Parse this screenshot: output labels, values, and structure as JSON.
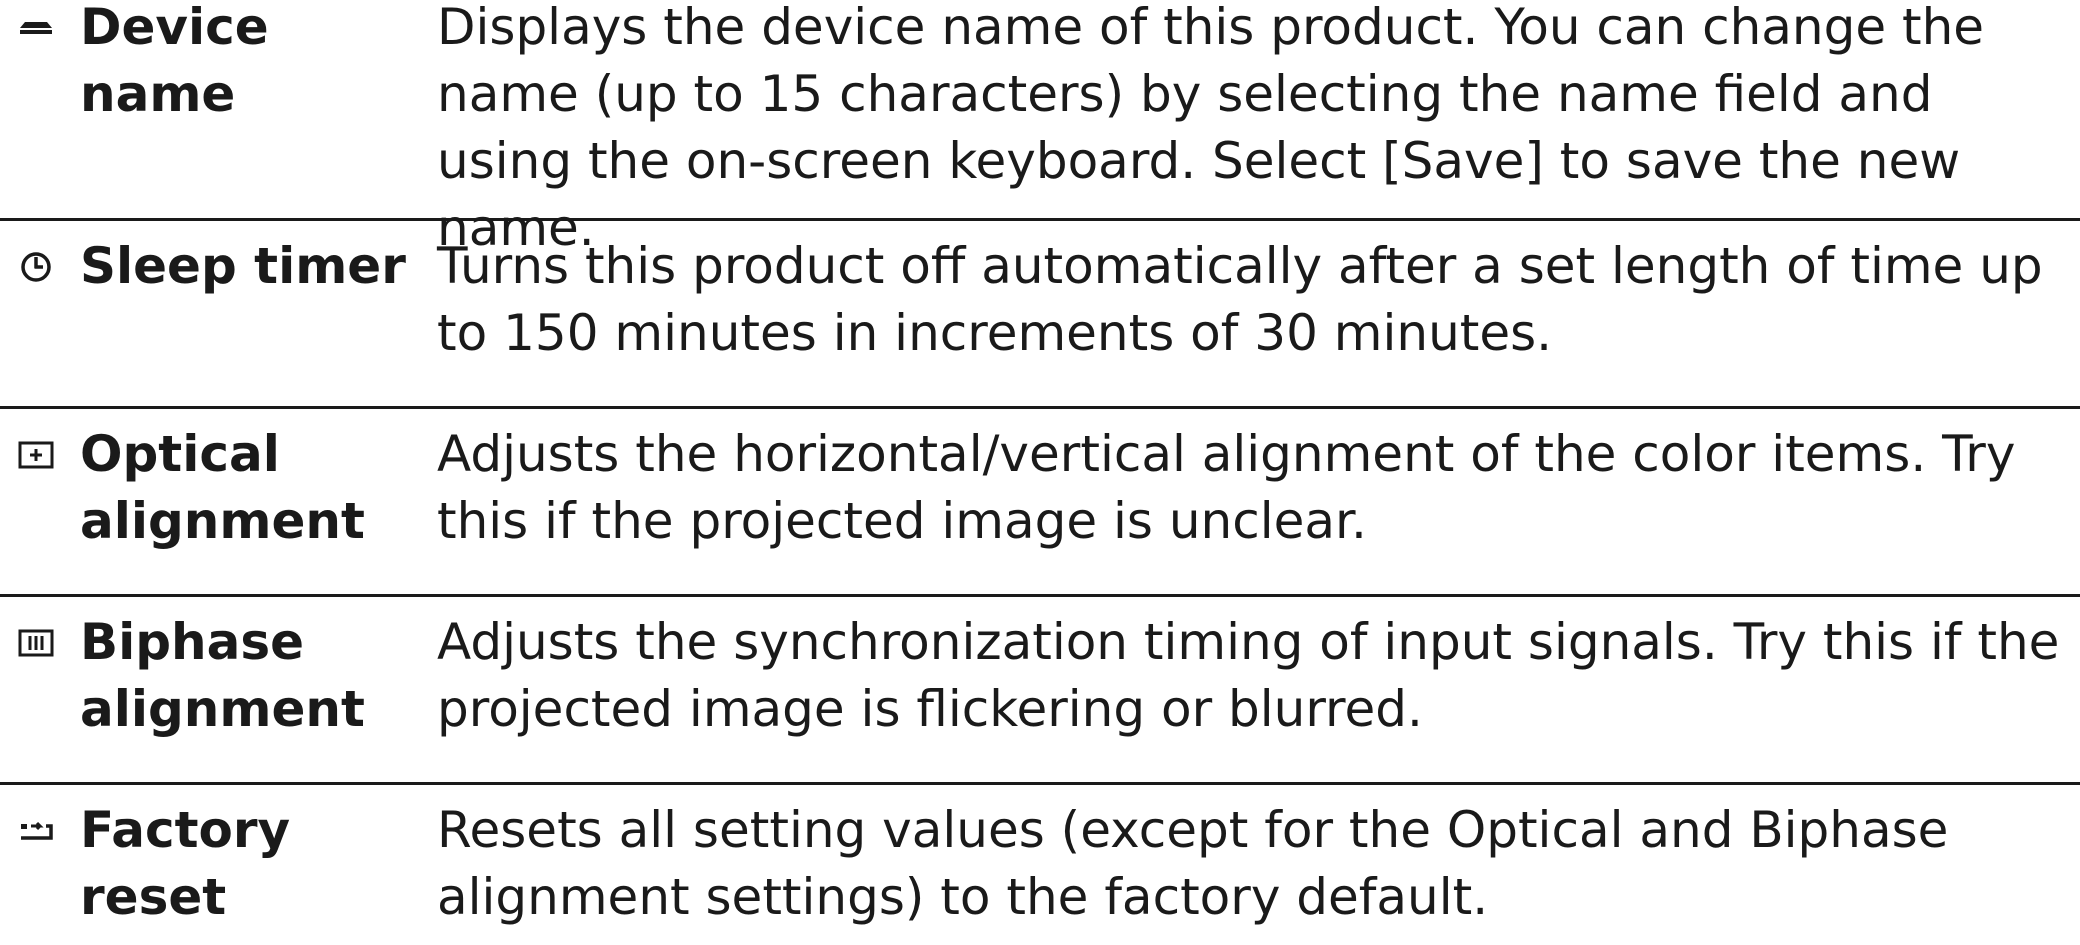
{
  "rows": [
    {
      "icon": "device-name-icon",
      "term": "Device name",
      "description": "Displays the device name of this product. You can change the name (up to 15 characters) by selecting the name field and using the on-screen keyboard. Select [Save] to save the new name."
    },
    {
      "icon": "sleep-timer-icon",
      "term": "Sleep timer",
      "description": "Turns this product off automatically after a set length of time up to 150 minutes in increments of 30 minutes."
    },
    {
      "icon": "optical-alignment-icon",
      "term": "Optical alignment",
      "description": "Adjusts the horizontal/vertical alignment of the color items. Try this if the projected image is unclear."
    },
    {
      "icon": "biphase-alignment-icon",
      "term": "Biphase alignment",
      "description": "Adjusts the synchronization timing of input signals. Try this if the projected image is flickering or blurred."
    },
    {
      "icon": "factory-reset-icon",
      "term": "Factory reset",
      "description": "Resets all setting values (except for the Optical and Biphase alignment settings) to the factory default."
    }
  ]
}
